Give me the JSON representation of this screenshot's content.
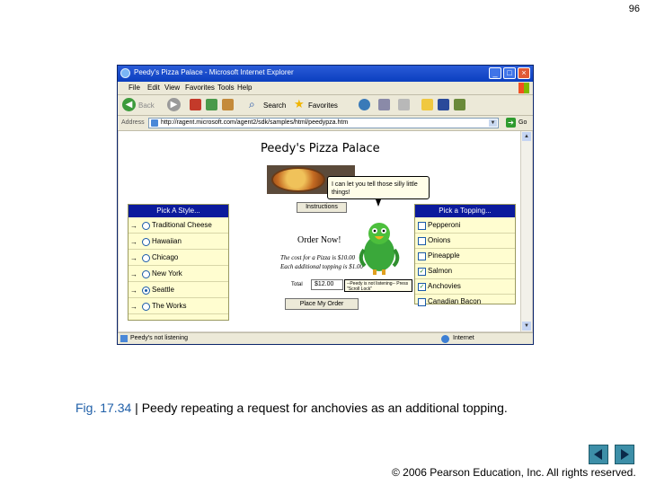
{
  "slide": {
    "number": "96"
  },
  "browser": {
    "title": "Peedy's Pizza Palace - Microsoft Internet Explorer",
    "menu": [
      "File",
      "Edit",
      "View",
      "Favorites",
      "Tools",
      "Help"
    ],
    "toolbar": {
      "back": "Back",
      "search": "Search",
      "favorites": "Favorites"
    },
    "address_label": "Address",
    "url": "http://ragent.microsoft.com/agent2/sdk/samples/html/peedypza.htm",
    "go_label": "Go",
    "status_text": "Peedy's not listening",
    "zone_text": "Internet"
  },
  "page": {
    "title": "Peedy's Pizza Palace",
    "bubble_text": "I can let you tell those silly little things!",
    "instructions_label": "Instructions",
    "style_panel": {
      "header": "Pick A Style...",
      "options": [
        {
          "label": "Traditional Cheese",
          "selected": false
        },
        {
          "label": "Hawaiian",
          "selected": false
        },
        {
          "label": "Chicago",
          "selected": false
        },
        {
          "label": "New York",
          "selected": false
        },
        {
          "label": "Seattle",
          "selected": true
        },
        {
          "label": "The Works",
          "selected": false
        }
      ]
    },
    "topping_panel": {
      "header": "Pick a Topping...",
      "options": [
        {
          "label": "Pepperoni",
          "checked": false
        },
        {
          "label": "Onions",
          "checked": false
        },
        {
          "label": "Pineapple",
          "checked": false
        },
        {
          "label": "Salmon",
          "checked": true
        },
        {
          "label": "Anchovies",
          "checked": true
        },
        {
          "label": "Canadian Bacon",
          "checked": false
        }
      ]
    },
    "order_title": "Order Now!",
    "cost_line_1": "The cost for a Pizza is $10.00",
    "cost_line_2": "Each additional topping is $1.00",
    "total_label": "Total",
    "total_value": "$12.00",
    "listening_tip": "--Peedy is not listening-- Press \"Scroll Lock\"",
    "order_button": "Place My Order"
  },
  "caption": {
    "fig_label": "Fig. 17.34",
    "separator": " | ",
    "text": "Peedy repeating a request for anchovies as an additional topping."
  },
  "copyright": "© 2006 Pearson Education, Inc.  All rights reserved."
}
